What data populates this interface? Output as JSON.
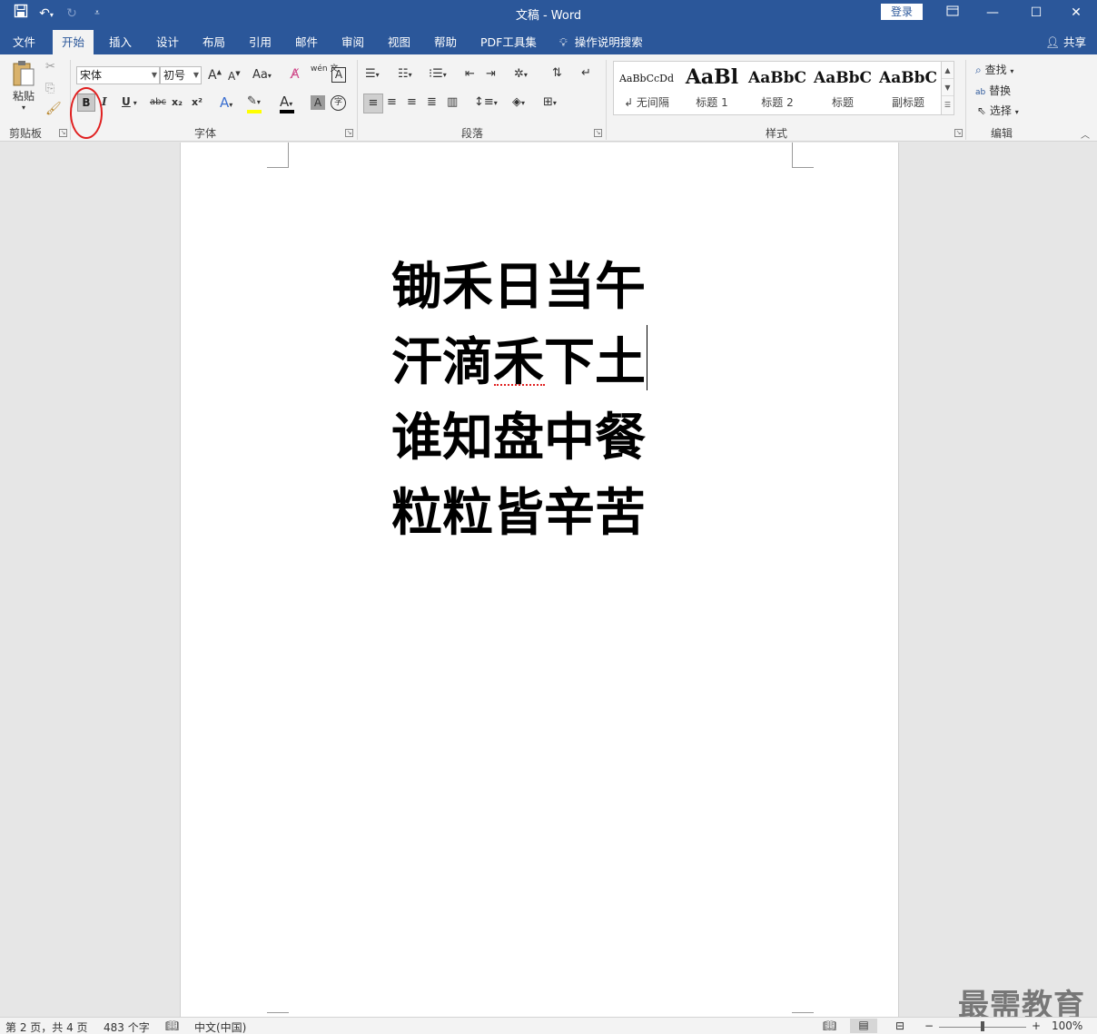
{
  "titlebar": {
    "title": "文稿  -  Word",
    "login": "登录",
    "qat_icons": [
      "save-icon",
      "undo-icon",
      "redo-icon",
      "customize-qat-icon"
    ],
    "window_controls": [
      "ribbon-display-icon",
      "minimize-icon",
      "maximize-icon",
      "close-icon"
    ]
  },
  "tabs": [
    "文件",
    "开始",
    "插入",
    "设计",
    "布局",
    "引用",
    "邮件",
    "审阅",
    "视图",
    "帮助",
    "PDF工具集",
    "操作说明搜索"
  ],
  "active_tab": "开始",
  "share": "共享",
  "ribbon": {
    "clipboard": {
      "paste": "粘贴",
      "label": "剪贴板"
    },
    "font": {
      "font_name": "宋体",
      "font_size": "初号",
      "label": "字体",
      "bold": "B",
      "italic": "I",
      "underline": "U",
      "strike": "abc",
      "subscript": "x₂",
      "superscript": "x²",
      "grow": "A",
      "shrink": "A",
      "change_case": "Aa",
      "phonetic": "wén 文",
      "border": "A",
      "font_color": "A",
      "shading": "A",
      "enclose": "字"
    },
    "paragraph": {
      "label": "段落"
    },
    "styles": {
      "label": "样式",
      "items": [
        {
          "sample": "AaBbCcDd",
          "name": "↲ 无间隔"
        },
        {
          "sample": "AaBl",
          "name": "标题 1"
        },
        {
          "sample": "AaBbC",
          "name": "标题 2"
        },
        {
          "sample": "AaBbC",
          "name": "标题"
        },
        {
          "sample": "AaBbC",
          "name": "副标题"
        }
      ]
    },
    "editing": {
      "label": "编辑",
      "find": "查找",
      "replace": "替换",
      "select": "选择"
    }
  },
  "document": {
    "lines": [
      "锄禾日当午",
      "汗滴禾下土",
      "谁知盘中餐",
      "粒粒皆辛苦"
    ]
  },
  "statusbar": {
    "page": "第 2 页，共 4 页",
    "words": "483 个字",
    "language": "中文(中国)",
    "zoom": "100%",
    "zoom_minus": "−",
    "zoom_plus": "+"
  },
  "watermark": "最需教育"
}
